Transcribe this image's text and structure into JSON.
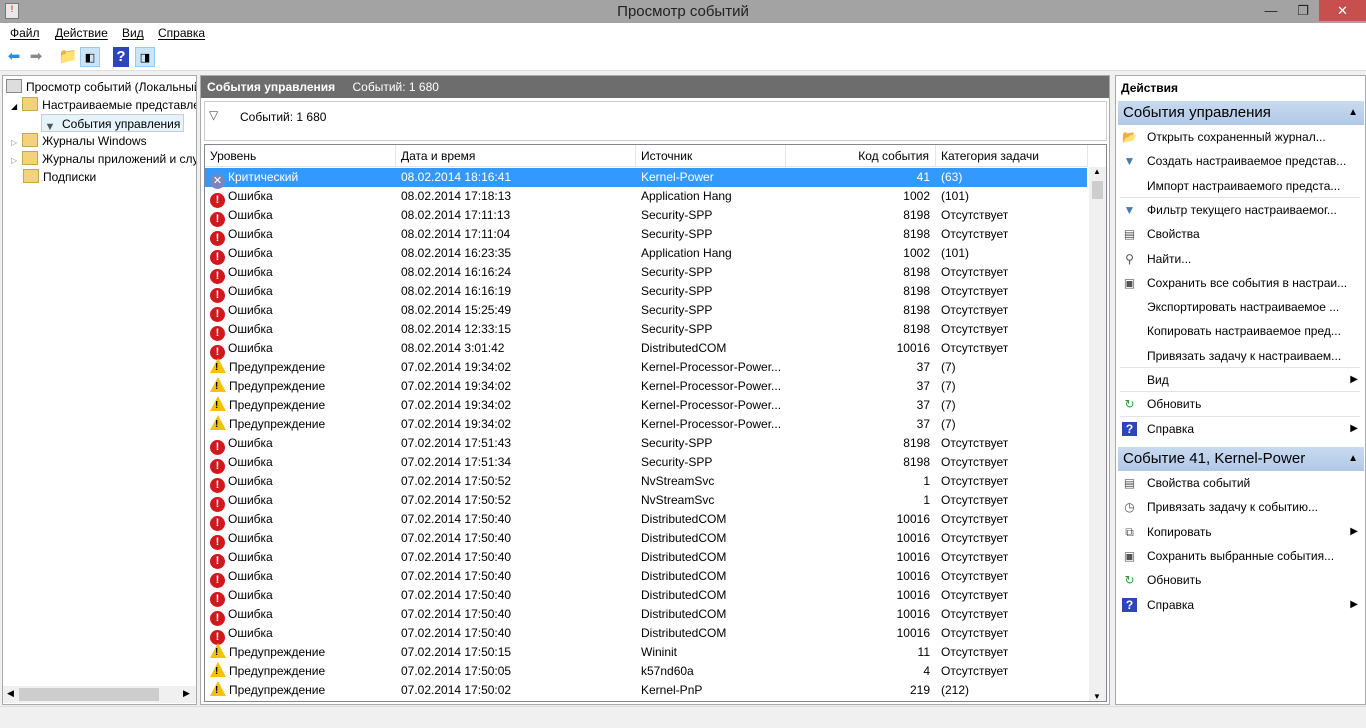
{
  "window": {
    "title": "Просмотр событий"
  },
  "menu": [
    "Файл",
    "Действие",
    "Вид",
    "Справка"
  ],
  "tree": {
    "root": "Просмотр событий (Локальный)",
    "custom_views": "Настраиваемые представления",
    "admin_events": "События управления",
    "windows_logs": "Журналы Windows",
    "app_logs": "Журналы приложений и служб",
    "subscriptions": "Подписки"
  },
  "center": {
    "title": "События управления",
    "count_label": "Событий: 1 680",
    "filter_count": "Событий: 1 680",
    "columns": [
      "Уровень",
      "Дата и время",
      "Источник",
      "Код события",
      "Категория задачи"
    ],
    "rows": [
      {
        "level": "Критический",
        "type": "crit",
        "date": "08.02.2014 18:16:41",
        "source": "Kernel-Power",
        "code": "41",
        "cat": "(63)"
      },
      {
        "level": "Ошибка",
        "type": "err",
        "date": "08.02.2014 17:18:13",
        "source": "Application Hang",
        "code": "1002",
        "cat": "(101)"
      },
      {
        "level": "Ошибка",
        "type": "err",
        "date": "08.02.2014 17:11:13",
        "source": "Security-SPP",
        "code": "8198",
        "cat": "Отсутствует"
      },
      {
        "level": "Ошибка",
        "type": "err",
        "date": "08.02.2014 17:11:04",
        "source": "Security-SPP",
        "code": "8198",
        "cat": "Отсутствует"
      },
      {
        "level": "Ошибка",
        "type": "err",
        "date": "08.02.2014 16:23:35",
        "source": "Application Hang",
        "code": "1002",
        "cat": "(101)"
      },
      {
        "level": "Ошибка",
        "type": "err",
        "date": "08.02.2014 16:16:24",
        "source": "Security-SPP",
        "code": "8198",
        "cat": "Отсутствует"
      },
      {
        "level": "Ошибка",
        "type": "err",
        "date": "08.02.2014 16:16:19",
        "source": "Security-SPP",
        "code": "8198",
        "cat": "Отсутствует"
      },
      {
        "level": "Ошибка",
        "type": "err",
        "date": "08.02.2014 15:25:49",
        "source": "Security-SPP",
        "code": "8198",
        "cat": "Отсутствует"
      },
      {
        "level": "Ошибка",
        "type": "err",
        "date": "08.02.2014 12:33:15",
        "source": "Security-SPP",
        "code": "8198",
        "cat": "Отсутствует"
      },
      {
        "level": "Ошибка",
        "type": "err",
        "date": "08.02.2014 3:01:42",
        "source": "DistributedCOM",
        "code": "10016",
        "cat": "Отсутствует"
      },
      {
        "level": "Предупреждение",
        "type": "warn",
        "date": "07.02.2014 19:34:02",
        "source": "Kernel-Processor-Power...",
        "code": "37",
        "cat": "(7)"
      },
      {
        "level": "Предупреждение",
        "type": "warn",
        "date": "07.02.2014 19:34:02",
        "source": "Kernel-Processor-Power...",
        "code": "37",
        "cat": "(7)"
      },
      {
        "level": "Предупреждение",
        "type": "warn",
        "date": "07.02.2014 19:34:02",
        "source": "Kernel-Processor-Power...",
        "code": "37",
        "cat": "(7)"
      },
      {
        "level": "Предупреждение",
        "type": "warn",
        "date": "07.02.2014 19:34:02",
        "source": "Kernel-Processor-Power...",
        "code": "37",
        "cat": "(7)"
      },
      {
        "level": "Ошибка",
        "type": "err",
        "date": "07.02.2014 17:51:43",
        "source": "Security-SPP",
        "code": "8198",
        "cat": "Отсутствует"
      },
      {
        "level": "Ошибка",
        "type": "err",
        "date": "07.02.2014 17:51:34",
        "source": "Security-SPP",
        "code": "8198",
        "cat": "Отсутствует"
      },
      {
        "level": "Ошибка",
        "type": "err",
        "date": "07.02.2014 17:50:52",
        "source": "NvStreamSvc",
        "code": "1",
        "cat": "Отсутствует"
      },
      {
        "level": "Ошибка",
        "type": "err",
        "date": "07.02.2014 17:50:52",
        "source": "NvStreamSvc",
        "code": "1",
        "cat": "Отсутствует"
      },
      {
        "level": "Ошибка",
        "type": "err",
        "date": "07.02.2014 17:50:40",
        "source": "DistributedCOM",
        "code": "10016",
        "cat": "Отсутствует"
      },
      {
        "level": "Ошибка",
        "type": "err",
        "date": "07.02.2014 17:50:40",
        "source": "DistributedCOM",
        "code": "10016",
        "cat": "Отсутствует"
      },
      {
        "level": "Ошибка",
        "type": "err",
        "date": "07.02.2014 17:50:40",
        "source": "DistributedCOM",
        "code": "10016",
        "cat": "Отсутствует"
      },
      {
        "level": "Ошибка",
        "type": "err",
        "date": "07.02.2014 17:50:40",
        "source": "DistributedCOM",
        "code": "10016",
        "cat": "Отсутствует"
      },
      {
        "level": "Ошибка",
        "type": "err",
        "date": "07.02.2014 17:50:40",
        "source": "DistributedCOM",
        "code": "10016",
        "cat": "Отсутствует"
      },
      {
        "level": "Ошибка",
        "type": "err",
        "date": "07.02.2014 17:50:40",
        "source": "DistributedCOM",
        "code": "10016",
        "cat": "Отсутствует"
      },
      {
        "level": "Ошибка",
        "type": "err",
        "date": "07.02.2014 17:50:40",
        "source": "DistributedCOM",
        "code": "10016",
        "cat": "Отсутствует"
      },
      {
        "level": "Предупреждение",
        "type": "warn",
        "date": "07.02.2014 17:50:15",
        "source": "Wininit",
        "code": "11",
        "cat": "Отсутствует"
      },
      {
        "level": "Предупреждение",
        "type": "warn",
        "date": "07.02.2014 17:50:05",
        "source": "k57nd60a",
        "code": "4",
        "cat": "Отсутствует"
      },
      {
        "level": "Предупреждение",
        "type": "warn",
        "date": "07.02.2014 17:50:02",
        "source": "Kernel-PnP",
        "code": "219",
        "cat": "(212)"
      }
    ]
  },
  "actions": {
    "title": "Действия",
    "section1": {
      "title": "События управления",
      "items": [
        {
          "label": "Открыть сохраненный журнал...",
          "icon": "open-folder",
          "glyph": "📂"
        },
        {
          "label": "Создать настраиваемое представ...",
          "icon": "filter-create",
          "glyph": "▼"
        },
        {
          "label": "Импорт настраиваемого предста...",
          "icon": "",
          "glyph": ""
        },
        {
          "label": "Фильтр текущего настраиваемог...",
          "icon": "filter",
          "glyph": "▼",
          "sep": true
        },
        {
          "label": "Свойства",
          "icon": "properties",
          "glyph": "▤"
        },
        {
          "label": "Найти...",
          "icon": "binoculars",
          "glyph": "⚲"
        },
        {
          "label": "Сохранить все события в настраи...",
          "icon": "save",
          "glyph": "▣"
        },
        {
          "label": "Экспортировать настраиваемое ...",
          "icon": "",
          "glyph": ""
        },
        {
          "label": "Копировать настраиваемое пред...",
          "icon": "",
          "glyph": ""
        },
        {
          "label": "Привязать задачу к настраиваем...",
          "icon": "",
          "glyph": ""
        },
        {
          "label": "Вид",
          "icon": "",
          "glyph": "",
          "sub": true,
          "sep": true
        },
        {
          "label": "Обновить",
          "icon": "refresh",
          "glyph": "↻",
          "sep": true
        },
        {
          "label": "Справка",
          "icon": "help",
          "glyph": "?",
          "sub": true,
          "sep": true
        }
      ]
    },
    "section2": {
      "title": "Событие 41, Kernel-Power",
      "items": [
        {
          "label": "Свойства событий",
          "icon": "properties",
          "glyph": "▤"
        },
        {
          "label": "Привязать задачу к событию...",
          "icon": "task",
          "glyph": "◷"
        },
        {
          "label": "Копировать",
          "icon": "copy",
          "glyph": "⧉",
          "sub": true
        },
        {
          "label": "Сохранить выбранные события...",
          "icon": "save",
          "glyph": "▣"
        },
        {
          "label": "Обновить",
          "icon": "refresh",
          "glyph": "↻"
        },
        {
          "label": "Справка",
          "icon": "help",
          "glyph": "?",
          "sub": true
        }
      ]
    }
  }
}
